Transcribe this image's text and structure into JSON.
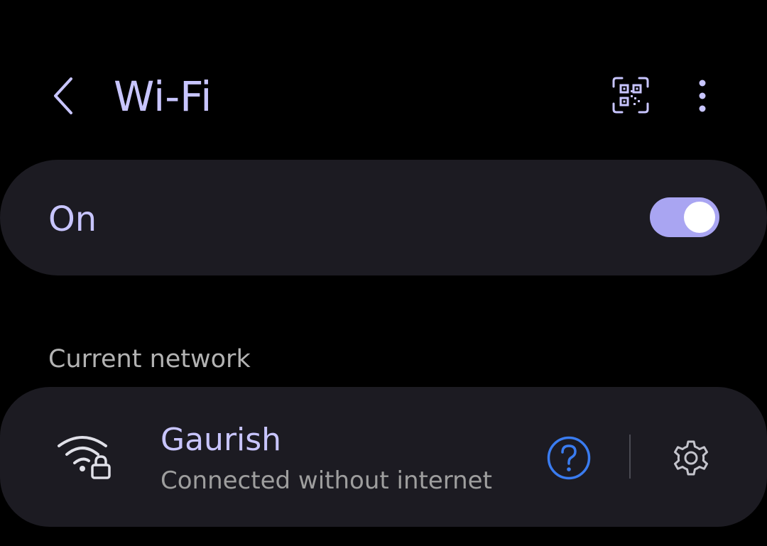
{
  "header": {
    "title": "Wi-Fi",
    "back_icon": "chevron-left-icon",
    "qr_icon": "qr-code-scan-icon",
    "more_icon": "more-vertical-icon"
  },
  "wifi_toggle": {
    "label": "On",
    "state": "on",
    "accent_color": "#a9a5f2"
  },
  "current_network_section": {
    "header": "Current network",
    "network": {
      "name": "Gaurish",
      "status": "Connected without internet",
      "signal_icon": "wifi-lock-icon",
      "help_icon": "question-circle-icon",
      "settings_icon": "gear-icon"
    }
  },
  "colors": {
    "background": "#000000",
    "card": "#1c1b22",
    "title_text": "#c8c5ff",
    "secondary_text": "#9e9e9e",
    "help_blue": "#3a7cf0"
  }
}
